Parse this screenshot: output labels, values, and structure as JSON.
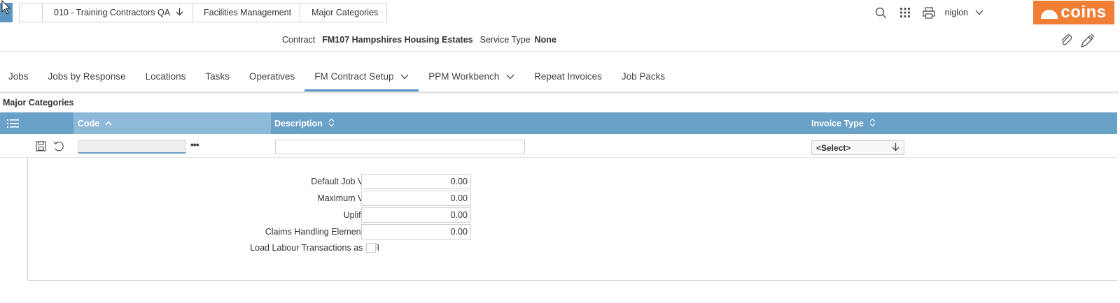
{
  "breadcrumbs": [
    {
      "label": "010 - Training Contractors QA"
    },
    {
      "label": "Facilities Management"
    },
    {
      "label": "Major Categories"
    }
  ],
  "header": {
    "user": "niglon",
    "logo_text": "coins",
    "brand_color": "#f07e35",
    "accent_color": "#6aa1c8"
  },
  "contract": {
    "contract_label": "Contract",
    "contract_value": "FM107 Hampshires Housing Estates",
    "service_type_label": "Service Type",
    "service_type_value": "None"
  },
  "tabs": [
    {
      "label": "Jobs"
    },
    {
      "label": "Jobs by Response"
    },
    {
      "label": "Locations"
    },
    {
      "label": "Tasks"
    },
    {
      "label": "Operatives"
    },
    {
      "label": "FM Contract Setup",
      "active": true,
      "dropdown": true
    },
    {
      "label": "PPM Workbench",
      "dropdown": true
    },
    {
      "label": "Repeat Invoices"
    },
    {
      "label": "Job Packs"
    }
  ],
  "section": {
    "title": "Major Categories"
  },
  "grid": {
    "columns": [
      {
        "label": "Code",
        "sort": "ascending"
      },
      {
        "label": "Description",
        "sort": "none"
      },
      {
        "label": "Invoice Type",
        "sort": "none"
      }
    ],
    "edit_row": {
      "code_value": "",
      "description_value": "",
      "invoice_type_value": "<Select>"
    }
  },
  "detail": {
    "fields": [
      {
        "label": "Default Job Value",
        "value": "0.00"
      },
      {
        "label": "Maximum Value",
        "value": "0.00"
      },
      {
        "label": "Uplift (%)",
        "value": "0.00"
      },
      {
        "label": "Claims Handling Element (%)",
        "value": "0.00"
      }
    ],
    "checkbox": {
      "label": "Load Labour Transactions as RFI",
      "checked": false
    }
  }
}
